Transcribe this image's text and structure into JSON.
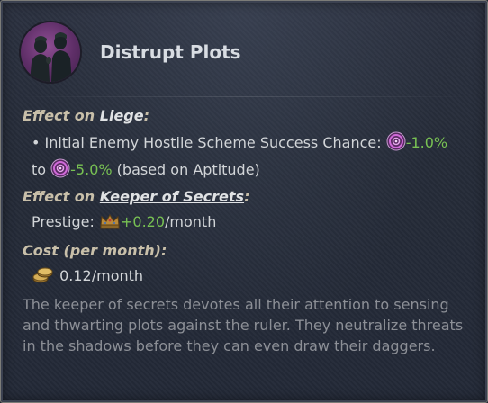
{
  "title": "Distrupt Plots",
  "colors": {
    "positive": "#78c153",
    "heading": "#c8bfa9",
    "scheme_icon": "#a84db2"
  },
  "effect_liege": {
    "heading_prefix": "Effect on ",
    "heading_target": "Liege",
    "heading_suffix": ":",
    "bullet": "•",
    "text": "Initial Enemy Hostile Scheme Success Chance:",
    "value_from": "-1.0%",
    "to_word": "to",
    "value_to": "-5.0%",
    "note": "(based on Aptitude)",
    "icon": "scheme-success-icon"
  },
  "effect_keeper": {
    "heading_prefix": "Effect on ",
    "heading_target": "Keeper of Secrets",
    "heading_suffix": ":",
    "label": "Prestige:",
    "value": "+0.20",
    "unit": "/month",
    "icon": "prestige-crown-icon"
  },
  "cost": {
    "heading": "Cost (per month):",
    "value": "0.12/month",
    "icon": "gold-coins-icon"
  },
  "description": "The keeper of secrets devotes all their attention to sensing and thwarting plots against the ruler. They neutralize threats in the shadows before they can even draw their daggers."
}
